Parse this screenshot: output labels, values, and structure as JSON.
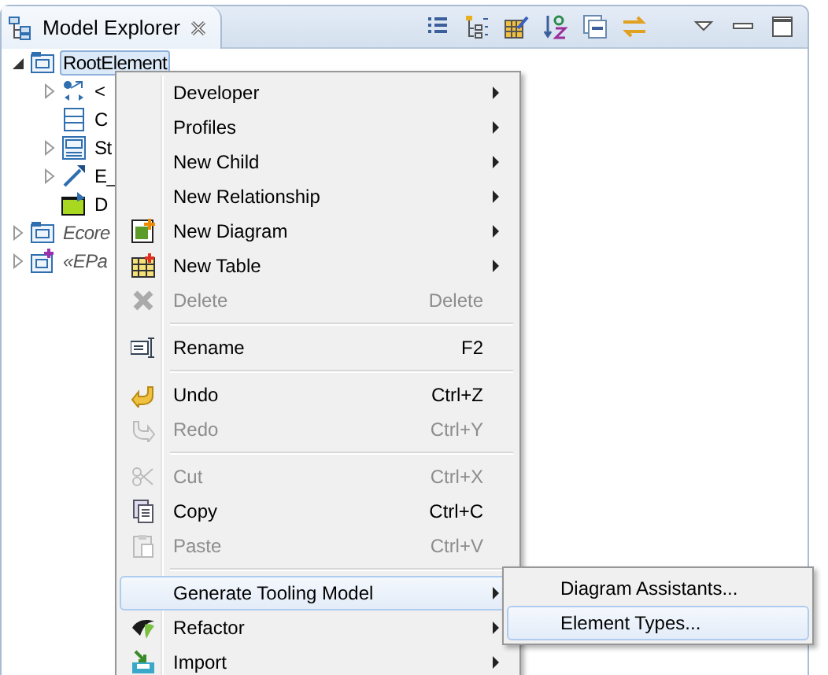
{
  "view": {
    "title": "Model Explorer"
  },
  "tree": [
    {
      "label": "RootElement",
      "kind": "profile",
      "expanded": true,
      "selected": true,
      "children": [
        {
          "label": "<",
          "kind": "assoc",
          "expanded": false,
          "selected": false
        },
        {
          "label": "C",
          "kind": "class",
          "selected": false
        },
        {
          "label": "St",
          "kind": "stereotype",
          "expanded": false,
          "selected": false
        },
        {
          "label": "E_",
          "kind": "link",
          "expanded": false,
          "selected": false
        },
        {
          "label": "D",
          "kind": "diagram",
          "selected": false
        }
      ]
    },
    {
      "label": "Ecore",
      "kind": "profile",
      "expanded": false,
      "selected": false,
      "italic": true
    },
    {
      "label": "«EPa",
      "kind": "profile-plus",
      "expanded": false,
      "selected": false,
      "italic": true
    }
  ],
  "menu": [
    [
      {
        "label": "Developer",
        "submenu": true,
        "disabled": false,
        "selected": false
      },
      {
        "label": "Profiles",
        "submenu": true,
        "disabled": false,
        "selected": false
      },
      {
        "label": "New Child",
        "submenu": true,
        "disabled": false,
        "selected": false
      },
      {
        "label": "New Relationship",
        "submenu": true,
        "disabled": false,
        "selected": false
      },
      {
        "label": "New Diagram",
        "kind": "diagram",
        "submenu": true,
        "disabled": false,
        "selected": false
      },
      {
        "label": "New Table",
        "kind": "table",
        "submenu": true,
        "disabled": false,
        "selected": false
      },
      {
        "label": "Delete",
        "kind": "delete",
        "shortcut": "Delete",
        "disabled": true,
        "selected": false
      }
    ],
    [
      {
        "label": "Rename",
        "kind": "rename",
        "shortcut": "F2",
        "disabled": false,
        "selected": false
      }
    ],
    [
      {
        "label": "Undo",
        "kind": "undo",
        "shortcut": "Ctrl+Z",
        "disabled": false,
        "selected": false
      },
      {
        "label": "Redo",
        "kind": "redo",
        "shortcut": "Ctrl+Y",
        "disabled": true,
        "selected": false
      }
    ],
    [
      {
        "label": "Cut",
        "kind": "cut",
        "shortcut": "Ctrl+X",
        "disabled": true,
        "selected": false
      },
      {
        "label": "Copy",
        "kind": "copy",
        "shortcut": "Ctrl+C",
        "disabled": false,
        "selected": false
      },
      {
        "label": "Paste",
        "kind": "paste",
        "shortcut": "Ctrl+V",
        "disabled": true,
        "selected": false
      }
    ],
    [
      {
        "label": "Generate Tooling Model",
        "submenu": true,
        "disabled": false,
        "selected": true
      },
      {
        "label": "Refactor",
        "kind": "refactor",
        "submenu": true,
        "disabled": false,
        "selected": false
      },
      {
        "label": "Import",
        "kind": "import",
        "submenu": true,
        "disabled": false,
        "selected": false
      }
    ]
  ],
  "submenu": [
    {
      "label": "Diagram Assistants...",
      "selected": false
    },
    {
      "label": "Element Types...",
      "selected": true
    }
  ]
}
